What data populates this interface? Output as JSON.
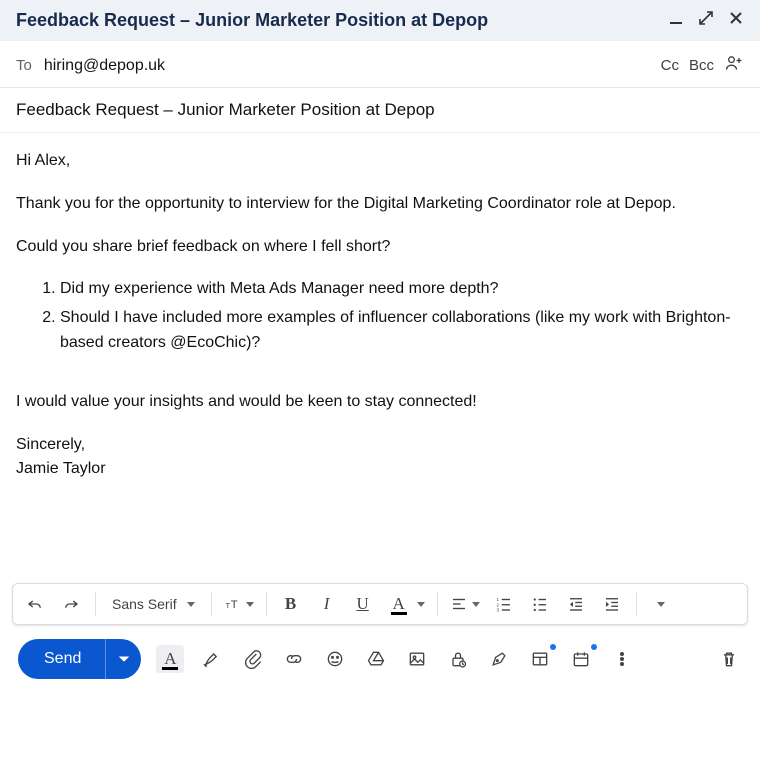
{
  "window": {
    "title": "Feedback Request – Junior Marketer Position at Depop"
  },
  "header": {
    "to_label": "To",
    "to_value": "hiring@depop.uk",
    "cc_label": "Cc",
    "bcc_label": "Bcc"
  },
  "subject": "Feedback Request – Junior Marketer Position at Depop",
  "body": {
    "greeting": "Hi Alex,",
    "p1": "Thank you for the opportunity to interview for the Digital Marketing Coordinator role at Depop.",
    "p2": "Could you share brief feedback on where I fell short?",
    "li1": "Did my experience with Meta Ads Manager need more depth?",
    "li2": "Should I have included more examples of influencer collaborations (like my work with Brighton-based creators @EcoChic)?",
    "p3": "I would value your insights and would be keen to stay connected!",
    "sign1": "Sincerely,",
    "sign2": "Jamie Taylor"
  },
  "formatbar": {
    "font": "Sans Serif",
    "bold": "B",
    "italic": "I",
    "underline": "U",
    "textcolor": "A"
  },
  "actions": {
    "send": "Send",
    "a_color": "A"
  }
}
